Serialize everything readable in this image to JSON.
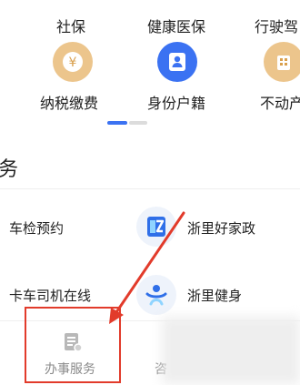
{
  "top_grid": {
    "row1": [
      {
        "label": "社保"
      },
      {
        "label": "健康医保"
      },
      {
        "label": "行驶驾"
      }
    ],
    "row2": [
      {
        "label": "纳税缴费",
        "icon": "yuan-coin-icon"
      },
      {
        "label": "身份户籍",
        "icon": "id-card-icon"
      },
      {
        "label": "不动产",
        "icon": "property-icon"
      }
    ]
  },
  "section": {
    "title_fragment": "务"
  },
  "services": [
    {
      "label": "车检预约"
    },
    {
      "label": "浙里好家政",
      "icon": "housekeeping-icon"
    },
    {
      "label": "卡车司机在线"
    },
    {
      "label": "浙里健身",
      "icon": "fitness-icon"
    }
  ],
  "tabbar": {
    "tabs": [
      {
        "label": "办事服务",
        "icon": "document-icon"
      },
      {
        "label": "咨"
      }
    ]
  },
  "colors": {
    "gold": "#ecc58c",
    "blue": "#3b72f2",
    "annotation_red": "#e23b2b"
  }
}
